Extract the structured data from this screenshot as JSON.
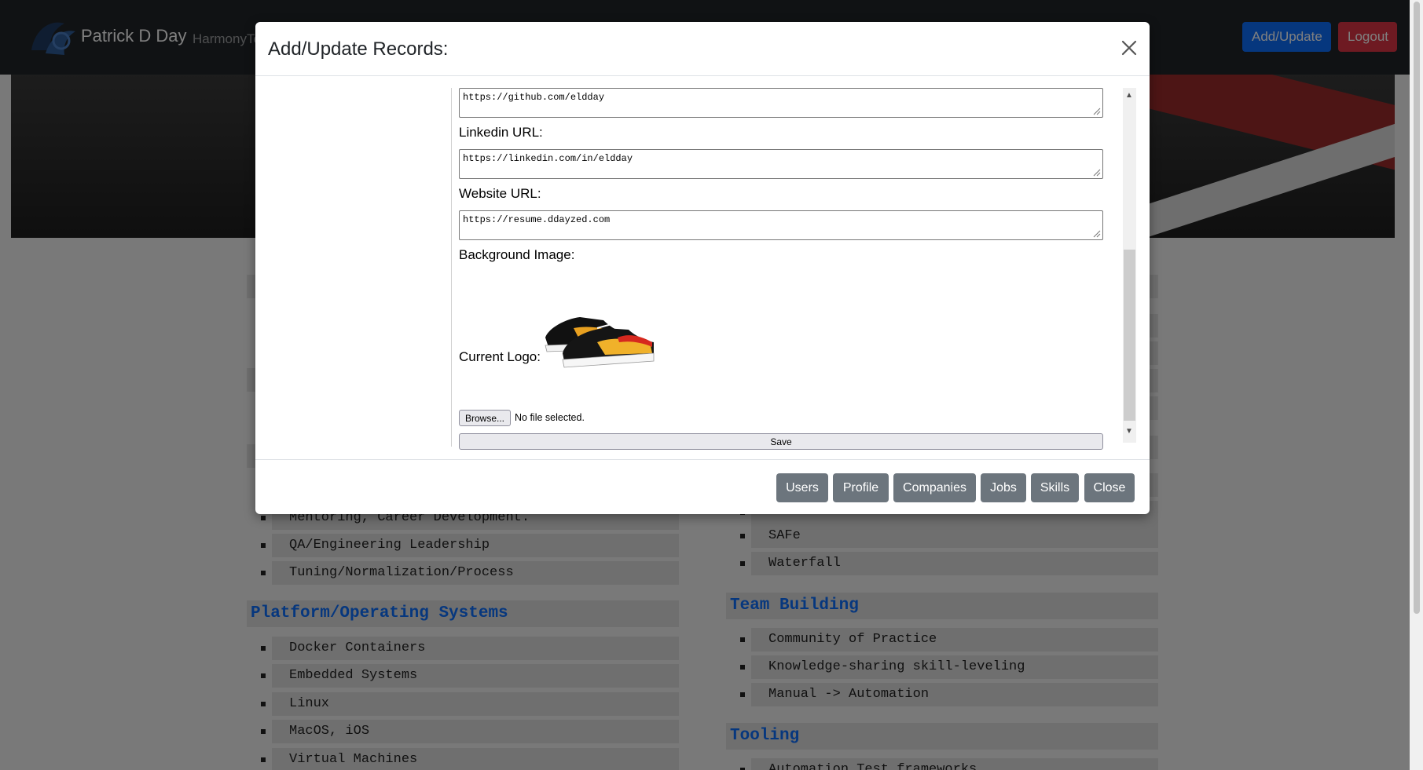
{
  "navbar": {
    "brand_name": "Patrick D Day",
    "nav_link": "HarmonyTe",
    "add_update_label": "Add/Update",
    "logout_label": "Logout",
    "colors": {
      "add": "#0d6efd",
      "logout": "#dc3545",
      "bg": "#212529"
    }
  },
  "page": {
    "left_column": [
      {
        "type": "heading",
        "text": "Platform/Operating Systems"
      },
      {
        "type": "item",
        "text": "Mentoring, Career Development."
      },
      {
        "type": "item",
        "text": "QA/Engineering Leadership"
      },
      {
        "type": "item",
        "text": "Tuning/Normalization/Process"
      },
      {
        "type": "item",
        "text": "Docker Containers"
      },
      {
        "type": "item",
        "text": "Embedded Systems"
      },
      {
        "type": "item",
        "text": "Linux"
      },
      {
        "type": "item",
        "text": "MacOS, iOS"
      },
      {
        "type": "item",
        "text": "Virtual Machines"
      }
    ],
    "right_column": [
      {
        "type": "item",
        "text": "SAFe"
      },
      {
        "type": "item",
        "text": "Waterfall"
      },
      {
        "type": "heading",
        "text": "Team Building"
      },
      {
        "type": "item",
        "text": "Community of Practice"
      },
      {
        "type": "item",
        "text": "Knowledge-sharing skill-leveling"
      },
      {
        "type": "item",
        "text": "Manual -> Automation"
      },
      {
        "type": "heading",
        "text": "Tooling"
      },
      {
        "type": "item",
        "text": "Automation Test frameworks"
      }
    ]
  },
  "modal": {
    "title": "Add/Update Records:",
    "github_value": "https://github.com/eldday",
    "linkedin_label": "Linkedin URL:",
    "linkedin_value": "https://linkedin.com/in/eldday",
    "website_label": "Website URL:",
    "website_value": "https://resume.ddayzed.com",
    "background_label": "Background Image:",
    "logo_label": "Current Logo:",
    "browse_label": "Browse...",
    "no_file_text": "No file selected.",
    "save_label": "Save",
    "footer_buttons": [
      "Users",
      "Profile",
      "Companies",
      "Jobs",
      "Skills",
      "Close"
    ],
    "footer_color": "#6c757d"
  }
}
